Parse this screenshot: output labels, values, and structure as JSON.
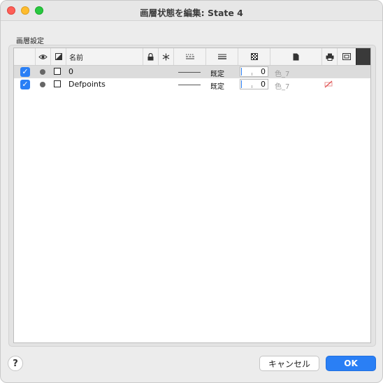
{
  "window": {
    "title": "画層状態を編集: State 4"
  },
  "group": {
    "label": "画層設定"
  },
  "table": {
    "columns": {
      "name": "名前",
      "linetype_label": "既定"
    },
    "rows": [
      {
        "name": "0",
        "on": true,
        "lineweight": "既定",
        "transparency": "0",
        "color": "色_7",
        "plot": ""
      },
      {
        "name": "Defpoints",
        "on": true,
        "lineweight": "既定",
        "transparency": "0",
        "color": "色_7",
        "plot": "no-plot"
      }
    ]
  },
  "footer": {
    "help_label": "?",
    "cancel_label": "キャンセル",
    "ok_label": "OK"
  },
  "colors": {
    "accent": "#2a7ff5",
    "selected_row": "#dcdcdc"
  }
}
